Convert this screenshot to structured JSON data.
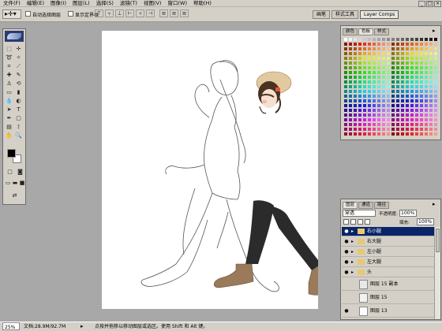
{
  "menu": {
    "items": [
      {
        "label": "文件(F)"
      },
      {
        "label": "编辑(E)"
      },
      {
        "label": "图像(I)"
      },
      {
        "label": "图层(L)"
      },
      {
        "label": "选择(S)"
      },
      {
        "label": "滤镜(T)"
      },
      {
        "label": "视图(V)"
      },
      {
        "label": "窗口(W)"
      },
      {
        "label": "帮助(H)"
      }
    ]
  },
  "options": {
    "auto_select_label": "自动选择图层",
    "show_bounds_label": "显示定界框",
    "well_tabs": [
      {
        "label": "画笔"
      },
      {
        "label": "样式工具"
      },
      {
        "label": "Layer Comps"
      }
    ]
  },
  "color_panel": {
    "tabs": [
      {
        "label": "颜色"
      },
      {
        "label": "色板"
      },
      {
        "label": "样式"
      }
    ]
  },
  "layers_panel": {
    "tabs": [
      {
        "label": "图层"
      },
      {
        "label": "通道"
      },
      {
        "label": "路径"
      }
    ],
    "blend_mode": "穿透",
    "opacity_label": "不透明度:",
    "opacity_value": "100%",
    "fill_label": "填充:",
    "fill_value": "100%",
    "layers": [
      {
        "name": "右小腿",
        "selected": true,
        "type": "group"
      },
      {
        "name": "右大腿",
        "selected": false,
        "type": "group"
      },
      {
        "name": "左小腿",
        "selected": false,
        "type": "group"
      },
      {
        "name": "左大腿",
        "selected": false,
        "type": "group"
      },
      {
        "name": "头",
        "selected": false,
        "type": "group"
      },
      {
        "name": "图层 15 副本",
        "selected": false,
        "type": "layer"
      },
      {
        "name": "图层 15",
        "selected": false,
        "type": "layer"
      },
      {
        "name": "图层 13",
        "selected": false,
        "type": "layer"
      }
    ]
  },
  "status": {
    "zoom": "25%",
    "doc_size": "文档:28.9M/92.7M",
    "hint": "点按并拖移以移动图层或选区。使用 Shift 和 Alt 键。"
  },
  "colors": {
    "pants": "#2b2b2b",
    "boots": "#9a7a5a",
    "hair": "#4a3222",
    "hat": "#e2c9a0",
    "selected": "#0a246a"
  }
}
